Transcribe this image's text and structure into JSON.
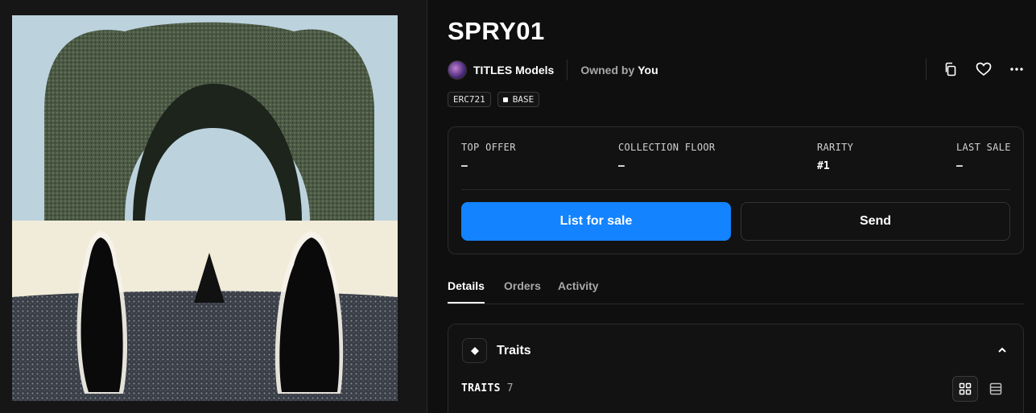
{
  "artwork": {
    "alt_subject": "artwork",
    "colors": {
      "sky": "#bcd3de",
      "hedge": "#4f5d48",
      "ground": "#f0ecd9",
      "field": "#3c4048",
      "figures": "#0a0a0a"
    }
  },
  "header": {
    "title": "SPRY01",
    "collection_name": "TITLES Models",
    "owned_by_label": "Owned by",
    "owner_name": "You",
    "actions": [
      "copy-icon",
      "heart-icon",
      "more-icon"
    ]
  },
  "badges": [
    {
      "label": "ERC721",
      "icon": ""
    },
    {
      "label": "BASE",
      "icon": "square-dot-icon"
    }
  ],
  "stats": {
    "top_offer": {
      "label": "TOP OFFER",
      "value": "–"
    },
    "collection_floor": {
      "label": "COLLECTION FLOOR",
      "value": "–"
    },
    "rarity": {
      "label": "RARITY",
      "value": "#1"
    },
    "last_sale": {
      "label": "LAST SALE",
      "value": "–"
    }
  },
  "buttons": {
    "list_for_sale": "List for sale",
    "send": "Send",
    "primary_color": "#1383ff"
  },
  "tabs": [
    {
      "label": "Details",
      "active": true
    },
    {
      "label": "Orders",
      "active": false
    },
    {
      "label": "Activity",
      "active": false
    }
  ],
  "traits": {
    "title": "Traits",
    "count_label": "TRAITS",
    "count": "7",
    "view_modes": [
      "grid-icon",
      "list-icon"
    ]
  }
}
